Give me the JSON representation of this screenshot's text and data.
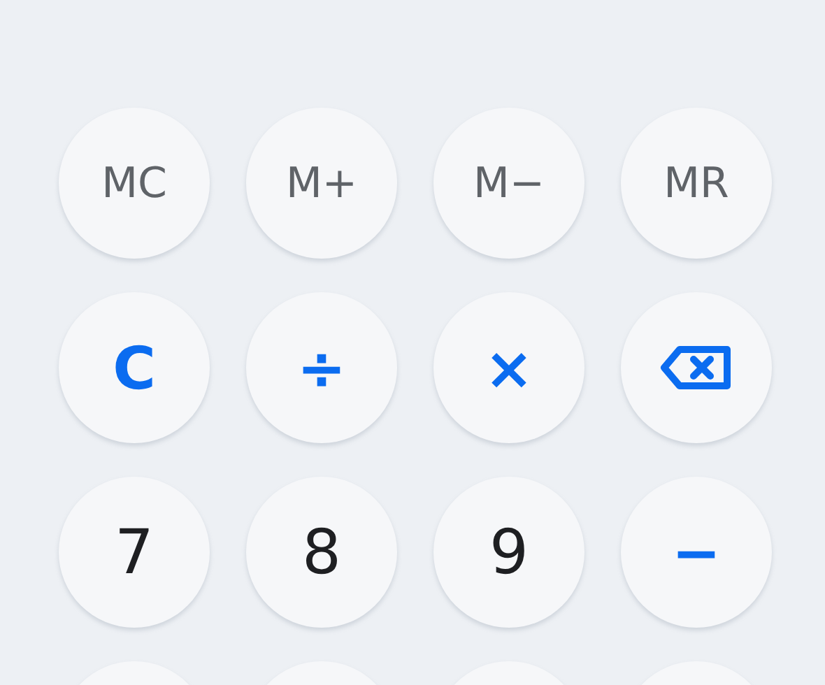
{
  "keypad": [
    [
      {
        "kind": "memory",
        "label": "MC"
      },
      {
        "kind": "memory",
        "label": "M+"
      },
      {
        "kind": "memory",
        "label": "M−"
      },
      {
        "kind": "memory",
        "label": "MR"
      }
    ],
    [
      {
        "kind": "operator",
        "label": "C"
      },
      {
        "kind": "operator",
        "label": "÷"
      },
      {
        "kind": "operator",
        "label": "×"
      },
      {
        "kind": "backspace"
      }
    ],
    [
      {
        "kind": "digit",
        "label": "7"
      },
      {
        "kind": "digit",
        "label": "8"
      },
      {
        "kind": "digit",
        "label": "9"
      },
      {
        "kind": "operator",
        "label": "−"
      }
    ],
    [
      {
        "kind": "blank"
      },
      {
        "kind": "blank"
      },
      {
        "kind": "blank"
      },
      {
        "kind": "blank"
      }
    ]
  ]
}
